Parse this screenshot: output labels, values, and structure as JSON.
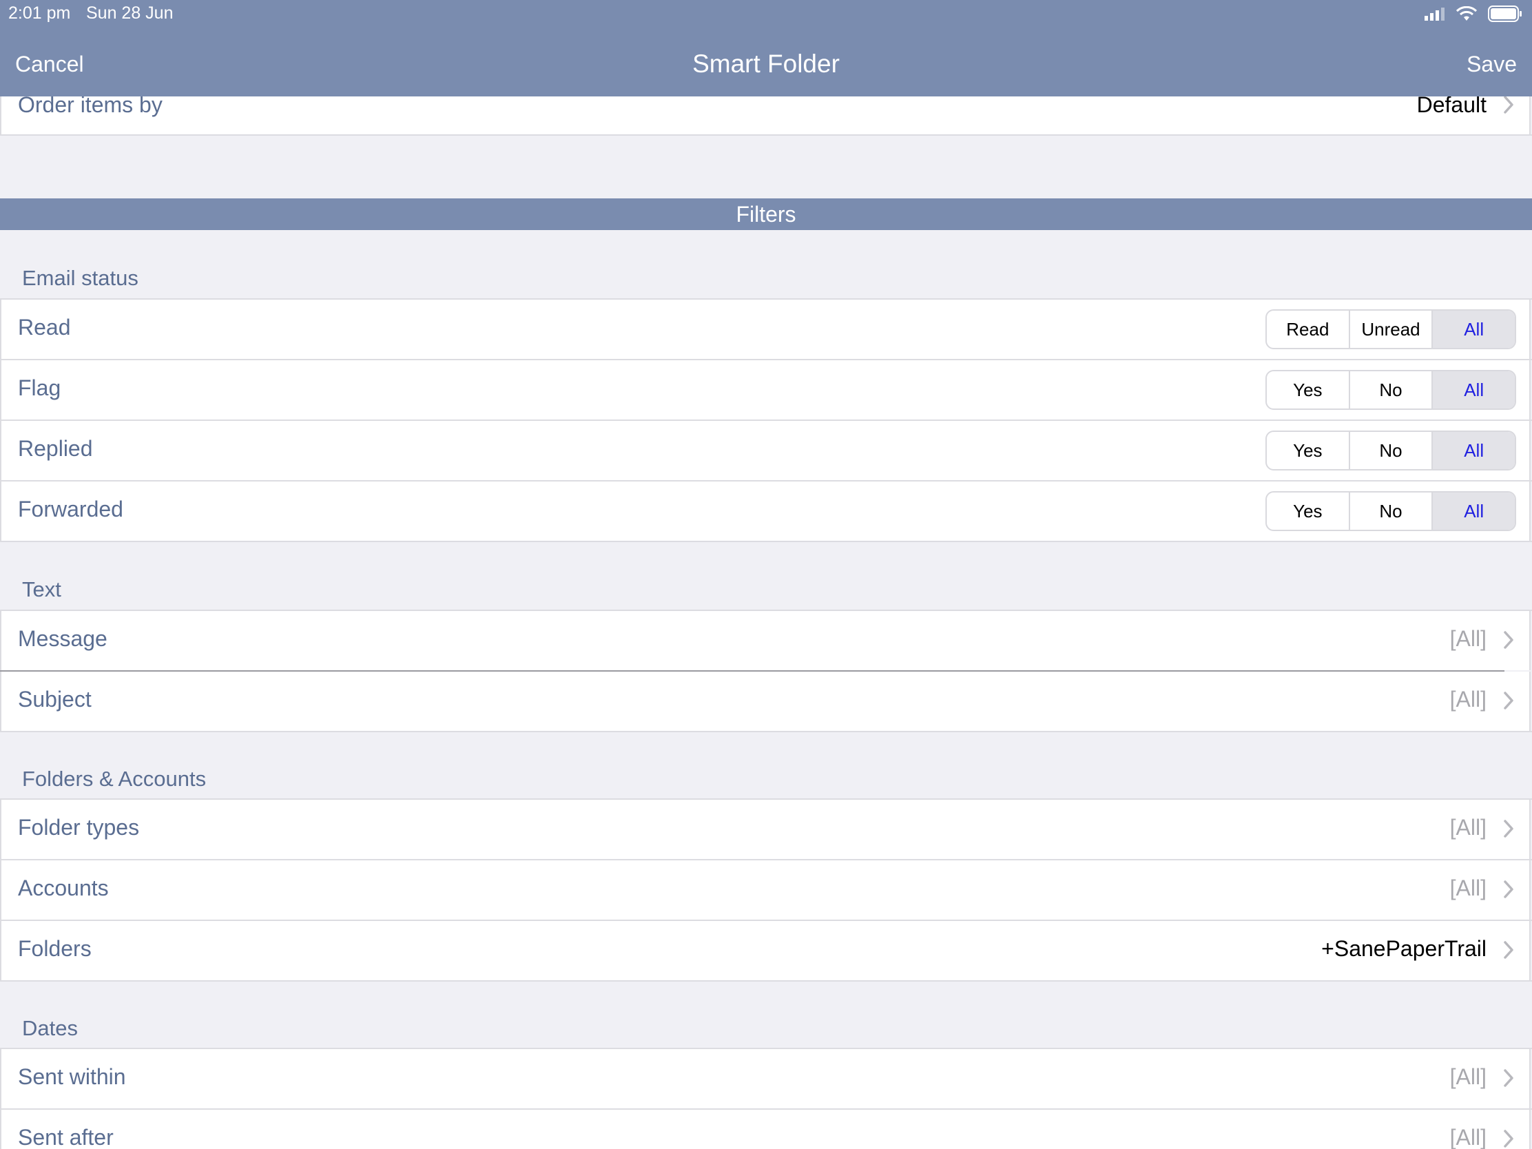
{
  "status_bar": {
    "time": "2:01 pm",
    "date": "Sun 28 Jun"
  },
  "nav": {
    "cancel": "Cancel",
    "title": "Smart Folder",
    "save": "Save"
  },
  "order": {
    "label": "Order items by",
    "value": "Default"
  },
  "filters_header": "Filters",
  "email_status": {
    "header": "Email status",
    "rows": [
      {
        "label": "Read",
        "options": [
          "Read",
          "Unread",
          "All"
        ],
        "selected": "All"
      },
      {
        "label": "Flag",
        "options": [
          "Yes",
          "No",
          "All"
        ],
        "selected": "All"
      },
      {
        "label": "Replied",
        "options": [
          "Yes",
          "No",
          "All"
        ],
        "selected": "All"
      },
      {
        "label": "Forwarded",
        "options": [
          "Yes",
          "No",
          "All"
        ],
        "selected": "All"
      }
    ]
  },
  "text": {
    "header": "Text",
    "rows": [
      {
        "label": "Message",
        "value": "[All]"
      },
      {
        "label": "Subject",
        "value": "[All]"
      }
    ]
  },
  "folders_accounts": {
    "header": "Folders & Accounts",
    "rows": [
      {
        "label": "Folder types",
        "value": "[All]"
      },
      {
        "label": "Accounts",
        "value": "[All]"
      },
      {
        "label": "Folders",
        "value": "+SanePaperTrail"
      }
    ]
  },
  "dates": {
    "header": "Dates",
    "rows": [
      {
        "label": "Sent within",
        "value": "[All]"
      },
      {
        "label": "Sent after",
        "value": "[All]"
      }
    ]
  },
  "colors": {
    "accent": "#7a8caf",
    "label": "#5a6d91",
    "selected_text": "#2020e0"
  }
}
